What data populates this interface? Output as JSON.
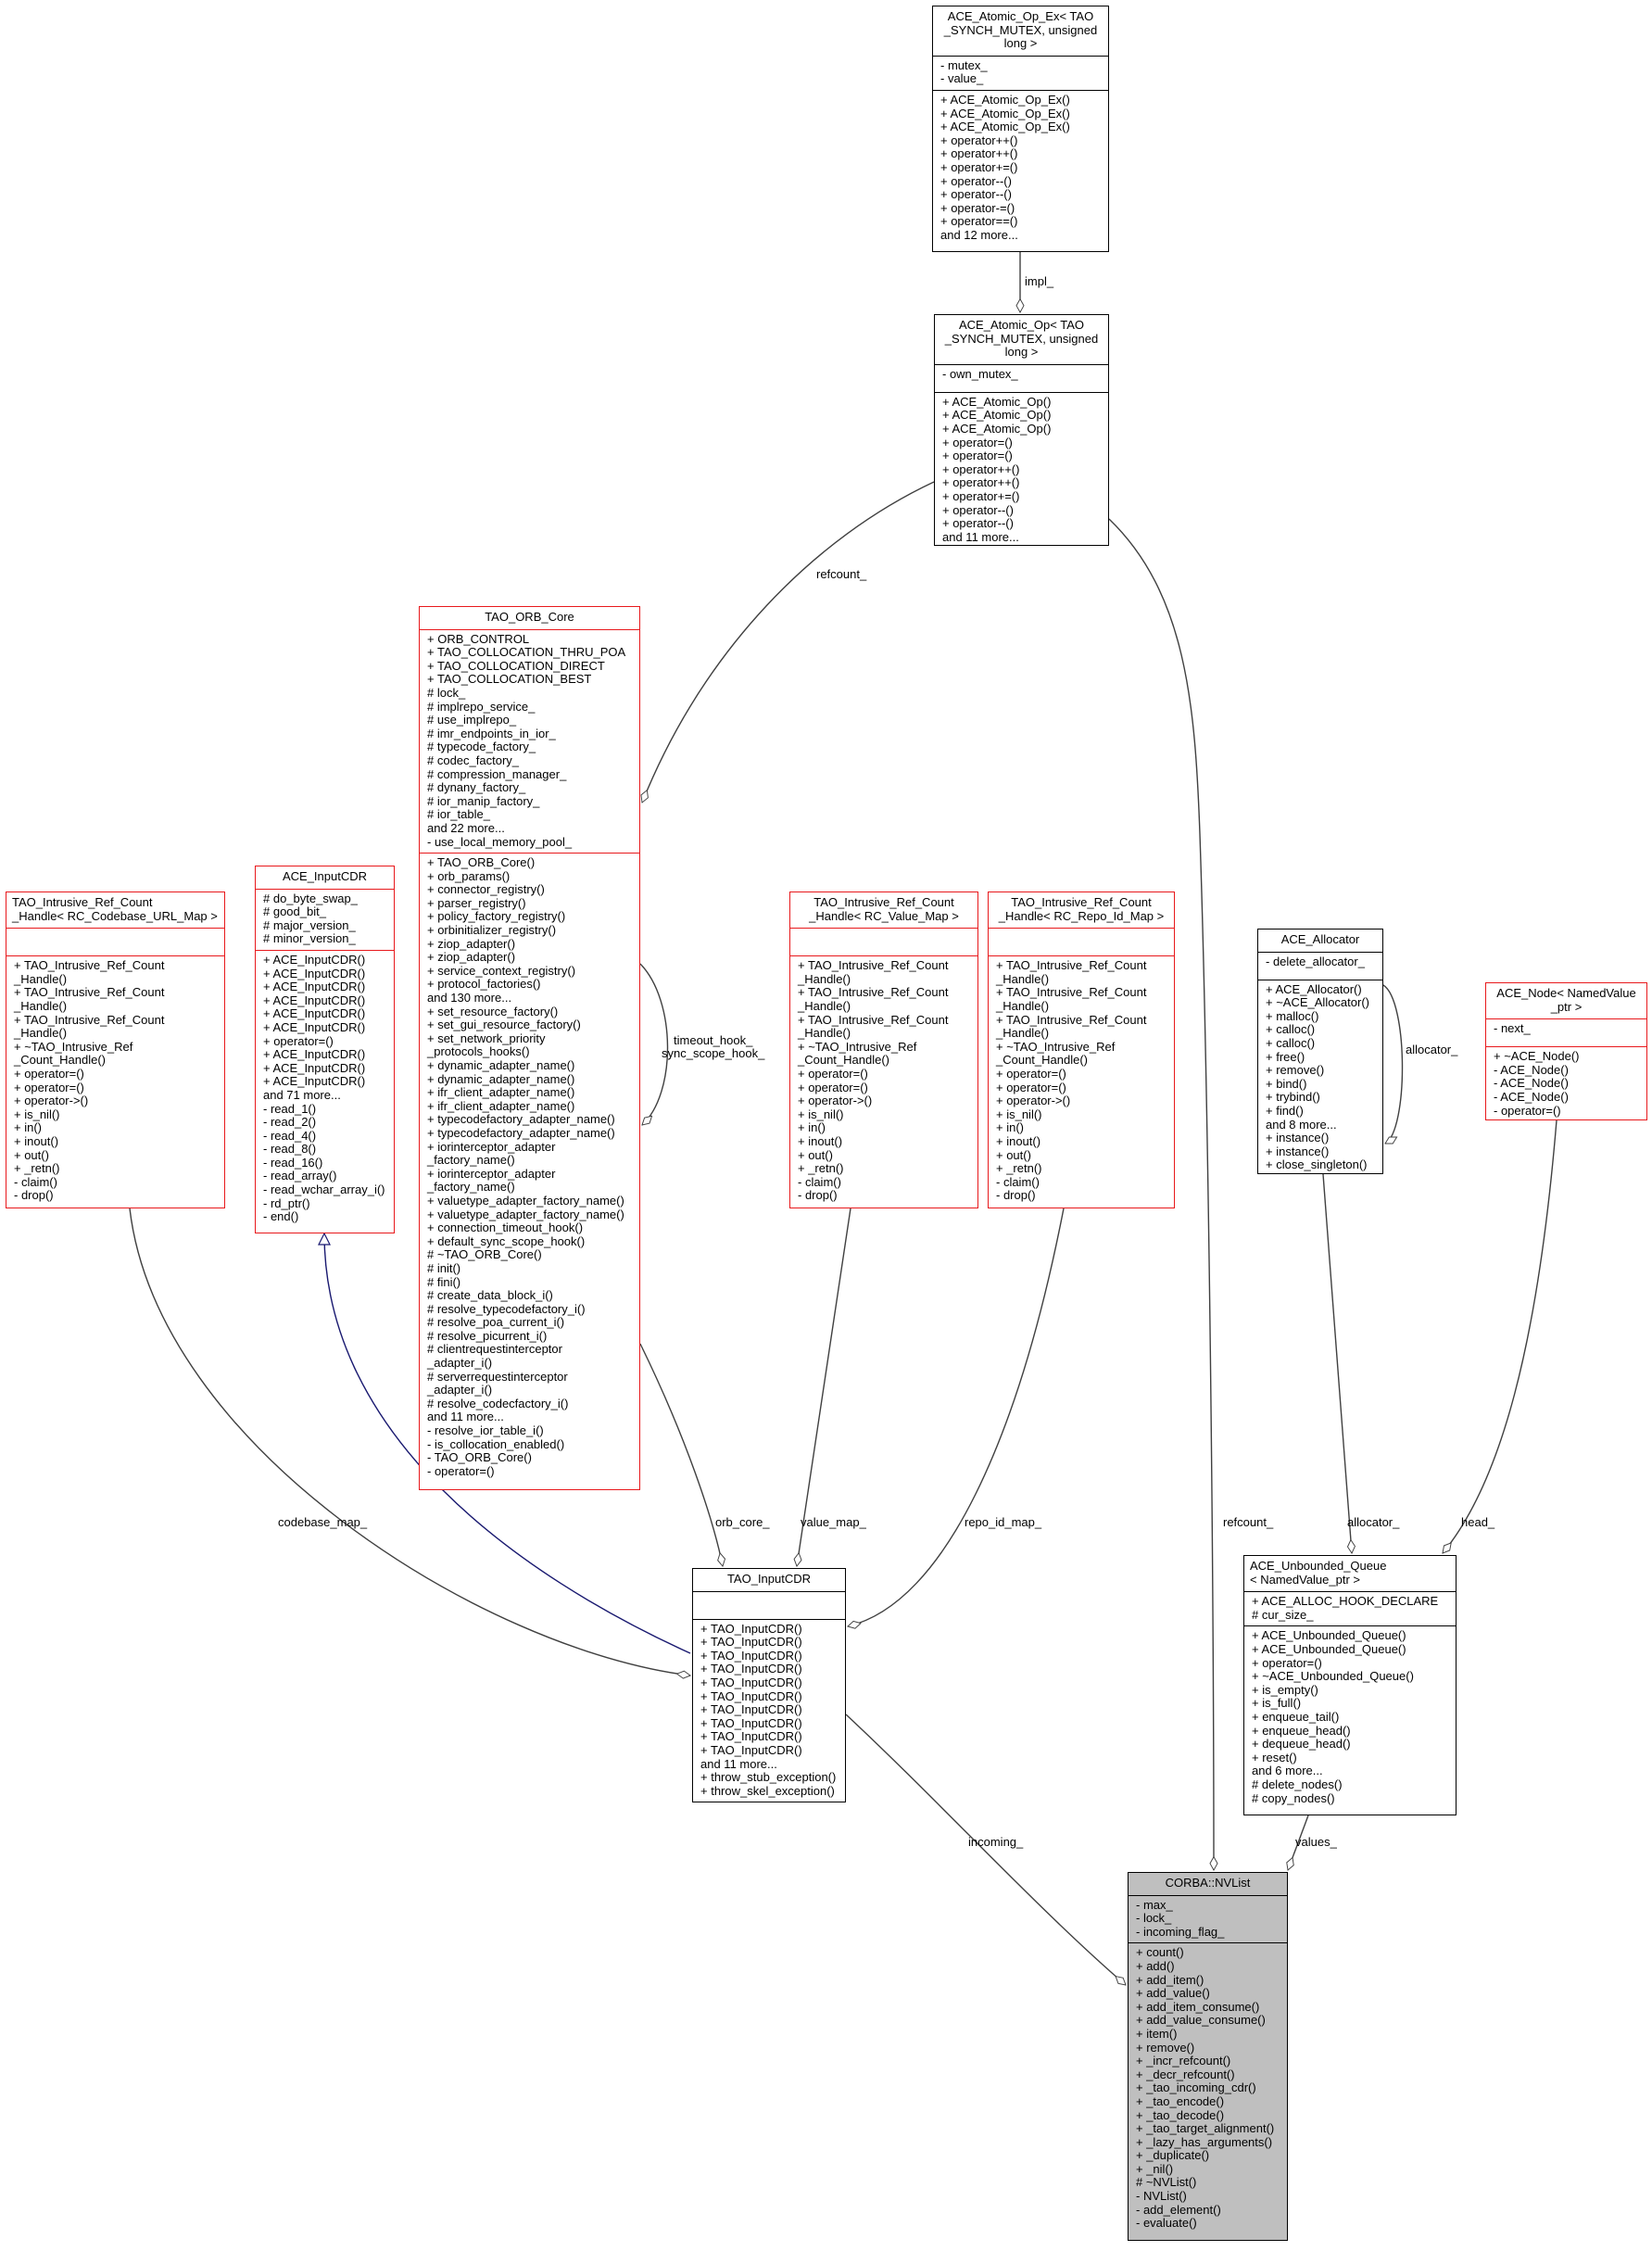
{
  "diagram": {
    "colors": {
      "border_default": "#000000",
      "border_incomplete": "#e8191c",
      "focus_fill": "#bfbfbf",
      "inheritance_edge": "#191970",
      "usage_edge": "#404040"
    },
    "nodes": {
      "atomic_op_ex": {
        "title": "ACE_Atomic_Op_Ex< TAO\n_SYNCH_MUTEX, unsigned\nlong >",
        "attrs": [
          "- mutex_",
          "- value_"
        ],
        "ops": [
          "+ ACE_Atomic_Op_Ex()",
          "+ ACE_Atomic_Op_Ex()",
          "+ ACE_Atomic_Op_Ex()",
          "+ operator++()",
          "+ operator++()",
          "+ operator+=()",
          "+ operator--()",
          "+ operator--()",
          "+ operator-=()",
          "+ operator==()",
          "and 12 more..."
        ]
      },
      "atomic_op": {
        "title": "ACE_Atomic_Op< TAO\n_SYNCH_MUTEX, unsigned\nlong >",
        "attrs": [
          "- own_mutex_"
        ],
        "ops": [
          "+ ACE_Atomic_Op()",
          "+ ACE_Atomic_Op()",
          "+ ACE_Atomic_Op()",
          "+ operator=()",
          "+ operator=()",
          "+ operator++()",
          "+ operator++()",
          "+ operator+=()",
          "+ operator--()",
          "+ operator--()",
          "and 11 more..."
        ]
      },
      "orb_core": {
        "title": "TAO_ORB_Core",
        "attrs": [
          "+ ORB_CONTROL",
          "+ TAO_COLLOCATION_THRU_POA",
          "+ TAO_COLLOCATION_DIRECT",
          "+ TAO_COLLOCATION_BEST",
          "# lock_",
          "# implrepo_service_",
          "# use_implrepo_",
          "# imr_endpoints_in_ior_",
          "# typecode_factory_",
          "# codec_factory_",
          "# compression_manager_",
          "# dynany_factory_",
          "# ior_manip_factory_",
          "# ior_table_",
          "and 22 more...",
          "- use_local_memory_pool_"
        ],
        "ops": [
          "+ TAO_ORB_Core()",
          "+ orb_params()",
          "+ connector_registry()",
          "+ parser_registry()",
          "+ policy_factory_registry()",
          "+ orbinitializer_registry()",
          "+ ziop_adapter()",
          "+ ziop_adapter()",
          "+ service_context_registry()",
          "+ protocol_factories()",
          "and 130 more...",
          "+ set_resource_factory()",
          "+ set_gui_resource_factory()",
          "+ set_network_priority",
          "_protocols_hooks()",
          "+ dynamic_adapter_name()",
          "+ dynamic_adapter_name()",
          "+ ifr_client_adapter_name()",
          "+ ifr_client_adapter_name()",
          "+ typecodefactory_adapter_name()",
          "+ typecodefactory_adapter_name()",
          "+ iorinterceptor_adapter",
          "_factory_name()",
          "+ iorinterceptor_adapter",
          "_factory_name()",
          "+ valuetype_adapter_factory_name()",
          "+ valuetype_adapter_factory_name()",
          "+ connection_timeout_hook()",
          "+ default_sync_scope_hook()",
          "# ~TAO_ORB_Core()",
          "# init()",
          "# fini()",
          "# create_data_block_i()",
          "# resolve_typecodefactory_i()",
          "# resolve_poa_current_i()",
          "# resolve_picurrent_i()",
          "# clientrequestinterceptor",
          "_adapter_i()",
          "# serverrequestinterceptor",
          "_adapter_i()",
          "# resolve_codecfactory_i()",
          "and 11 more...",
          "- resolve_ior_table_i()",
          "- is_collocation_enabled()",
          "- TAO_ORB_Core()",
          "- operator=()"
        ]
      },
      "codebase_handle": {
        "title": "TAO_Intrusive_Ref_Count\n_Handle< RC_Codebase_URL_Map >",
        "attrs": [],
        "ops": [
          "+ TAO_Intrusive_Ref_Count",
          "_Handle()",
          "+ TAO_Intrusive_Ref_Count",
          "_Handle()",
          "+ TAO_Intrusive_Ref_Count",
          "_Handle()",
          "+ ~TAO_Intrusive_Ref",
          "_Count_Handle()",
          "+ operator=()",
          "+ operator=()",
          "+ operator->()",
          "+ is_nil()",
          "+ in()",
          "+ inout()",
          "+ out()",
          "+ _retn()",
          "- claim()",
          "- drop()"
        ]
      },
      "ace_inputcdr": {
        "title": "ACE_InputCDR",
        "attrs": [
          "# do_byte_swap_",
          "# good_bit_",
          "# major_version_",
          "# minor_version_"
        ],
        "ops": [
          "+ ACE_InputCDR()",
          "+ ACE_InputCDR()",
          "+ ACE_InputCDR()",
          "+ ACE_InputCDR()",
          "+ ACE_InputCDR()",
          "+ ACE_InputCDR()",
          "+ operator=()",
          "+ ACE_InputCDR()",
          "+ ACE_InputCDR()",
          "+ ACE_InputCDR()",
          "and 71 more...",
          "- read_1()",
          "- read_2()",
          "- read_4()",
          "- read_8()",
          "- read_16()",
          "- read_array()",
          "- read_wchar_array_i()",
          "- rd_ptr()",
          "- end()"
        ]
      },
      "value_map_handle": {
        "title": "TAO_Intrusive_Ref_Count\n_Handle< RC_Value_Map >",
        "attrs": [],
        "ops": [
          "+ TAO_Intrusive_Ref_Count",
          "_Handle()",
          "+ TAO_Intrusive_Ref_Count",
          "_Handle()",
          "+ TAO_Intrusive_Ref_Count",
          "_Handle()",
          "+ ~TAO_Intrusive_Ref",
          "_Count_Handle()",
          "+ operator=()",
          "+ operator=()",
          "+ operator->()",
          "+ is_nil()",
          "+ in()",
          "+ inout()",
          "+ out()",
          "+ _retn()",
          "- claim()",
          "- drop()"
        ]
      },
      "repo_id_handle": {
        "title": "TAO_Intrusive_Ref_Count\n_Handle< RC_Repo_Id_Map >",
        "attrs": [],
        "ops": [
          "+ TAO_Intrusive_Ref_Count",
          "_Handle()",
          "+ TAO_Intrusive_Ref_Count",
          "_Handle()",
          "+ TAO_Intrusive_Ref_Count",
          "_Handle()",
          "+ ~TAO_Intrusive_Ref",
          "_Count_Handle()",
          "+ operator=()",
          "+ operator=()",
          "+ operator->()",
          "+ is_nil()",
          "+ in()",
          "+ inout()",
          "+ out()",
          "+ _retn()",
          "- claim()",
          "- drop()"
        ]
      },
      "allocator": {
        "title": "ACE_Allocator",
        "attrs": [
          "- delete_allocator_"
        ],
        "ops": [
          "+ ACE_Allocator()",
          "+ ~ACE_Allocator()",
          "+ malloc()",
          "+ calloc()",
          "+ calloc()",
          "+ free()",
          "+ remove()",
          "+ bind()",
          "+ trybind()",
          "+ find()",
          "and 8 more...",
          "+ instance()",
          "+ instance()",
          "+ close_singleton()"
        ]
      },
      "ace_node": {
        "title": "ACE_Node< NamedValue\n_ptr >",
        "attrs": [
          "- next_"
        ],
        "ops": [
          "+ ~ACE_Node()",
          "- ACE_Node()",
          "- ACE_Node()",
          "- ACE_Node()",
          "- operator=()"
        ]
      },
      "tao_inputcdr": {
        "title": "TAO_InputCDR",
        "attrs": [],
        "ops": [
          "+ TAO_InputCDR()",
          "+ TAO_InputCDR()",
          "+ TAO_InputCDR()",
          "+ TAO_InputCDR()",
          "+ TAO_InputCDR()",
          "+ TAO_InputCDR()",
          "+ TAO_InputCDR()",
          "+ TAO_InputCDR()",
          "+ TAO_InputCDR()",
          "+ TAO_InputCDR()",
          "and 11 more...",
          "+ throw_stub_exception()",
          "+ throw_skel_exception()"
        ]
      },
      "unbounded_queue": {
        "title": "ACE_Unbounded_Queue\n< NamedValue_ptr >",
        "attrs": [
          "+ ACE_ALLOC_HOOK_DECLARE",
          "# cur_size_"
        ],
        "ops": [
          "+ ACE_Unbounded_Queue()",
          "+ ACE_Unbounded_Queue()",
          "+ operator=()",
          "+ ~ACE_Unbounded_Queue()",
          "+ is_empty()",
          "+ is_full()",
          "+ enqueue_tail()",
          "+ enqueue_head()",
          "+ dequeue_head()",
          "+ reset()",
          "and 6 more...",
          "# delete_nodes()",
          "# copy_nodes()"
        ]
      },
      "nvlist": {
        "title": "CORBA::NVList",
        "attrs": [
          "- max_",
          "- lock_",
          "- incoming_flag_"
        ],
        "ops": [
          "+ count()",
          "+ add()",
          "+ add_item()",
          "+ add_value()",
          "+ add_item_consume()",
          "+ add_value_consume()",
          "+ item()",
          "+ remove()",
          "+ _incr_refcount()",
          "+ _decr_refcount()",
          "+ _tao_incoming_cdr()",
          "+ _tao_encode()",
          "+ _tao_decode()",
          "+ _tao_target_alignment()",
          "+ _lazy_has_arguments()",
          "+ _duplicate()",
          "+ _nil()",
          "# ~NVList()",
          "- NVList()",
          "- add_element()",
          "- evaluate()"
        ]
      }
    },
    "edge_labels": {
      "impl": "impl_",
      "refcount_top": "refcount_",
      "timeout_hook": "timeout_hook_\nsync_scope_hook_",
      "allocator_self": "allocator_",
      "codebase_map": "codebase_map_",
      "orb_core": "orb_core_",
      "value_map": "value_map_",
      "repo_id_map": "repo_id_map_",
      "refcount_bottom": "refcount_",
      "allocator": "allocator_",
      "head": "head_",
      "incoming": "incoming_",
      "values": "values_"
    }
  }
}
